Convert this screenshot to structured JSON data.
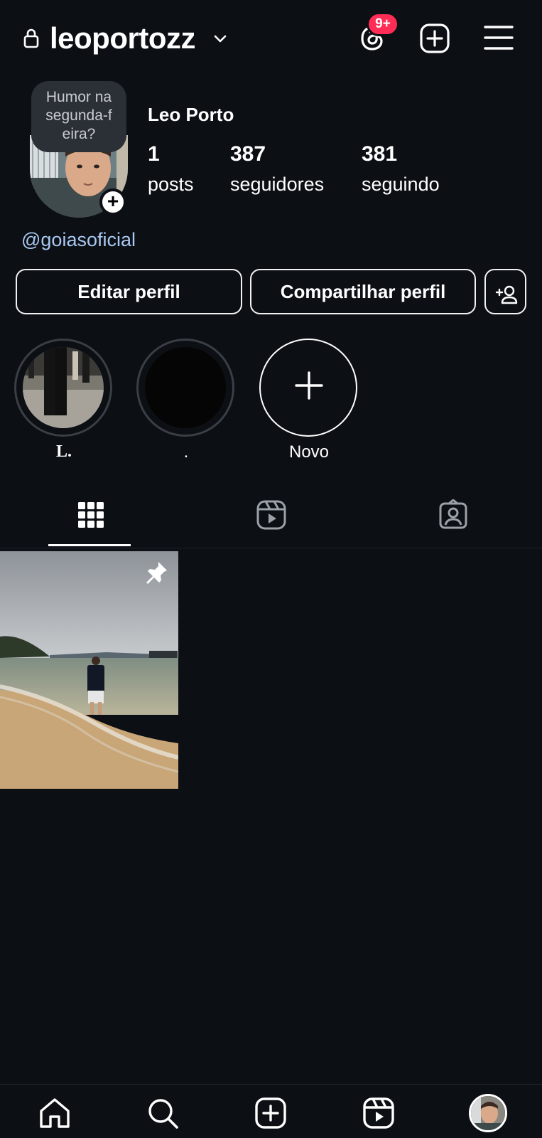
{
  "header": {
    "username": "leoportozz",
    "notification_badge": "9+"
  },
  "profile": {
    "note": [
      "Humor na",
      "segunda-f",
      "eira?"
    ],
    "display_name": "Leo Porto",
    "stats": {
      "posts": {
        "count": "1",
        "label": "posts"
      },
      "followers": {
        "count": "387",
        "label": "seguidores"
      },
      "following": {
        "count": "381",
        "label": "seguindo"
      }
    },
    "link": "@goiasoficial"
  },
  "buttons": {
    "edit": "Editar perfil",
    "share": "Compartilhar perfil"
  },
  "highlights": [
    {
      "label": "L."
    },
    {
      "label": "."
    },
    {
      "label": "Novo"
    }
  ],
  "colors": {
    "background": "#0c0f14",
    "badge": "#ff2d55",
    "link": "#a9c8f2"
  },
  "icons": {
    "tabs": [
      "grid-icon",
      "reels-icon",
      "tagged-icon"
    ],
    "nav": [
      "home-icon",
      "search-icon",
      "create-icon",
      "reels-icon",
      "profile-avatar"
    ]
  }
}
